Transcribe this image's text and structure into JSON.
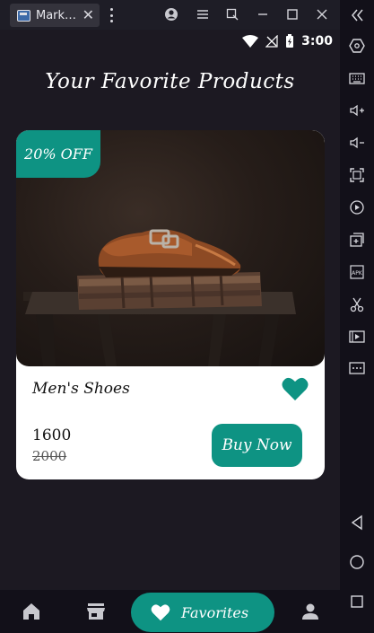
{
  "window": {
    "tab_title": "Mark…",
    "tab_close": "✕"
  },
  "status_bar": {
    "time": "3:00"
  },
  "page": {
    "title": "Your Favorite Products"
  },
  "product": {
    "discount_badge": "20% OFF",
    "name": "Men's Shoes",
    "price": "1600",
    "original_price": "2000",
    "buy_label": "Buy Now",
    "favorited": true
  },
  "bottom_nav": {
    "active_label": "Favorites",
    "items": [
      "home-icon",
      "store-icon",
      "heart-icon",
      "person-icon"
    ]
  },
  "colors": {
    "accent": "#0e9383",
    "background": "#1c1922",
    "card": "#ffffff"
  }
}
